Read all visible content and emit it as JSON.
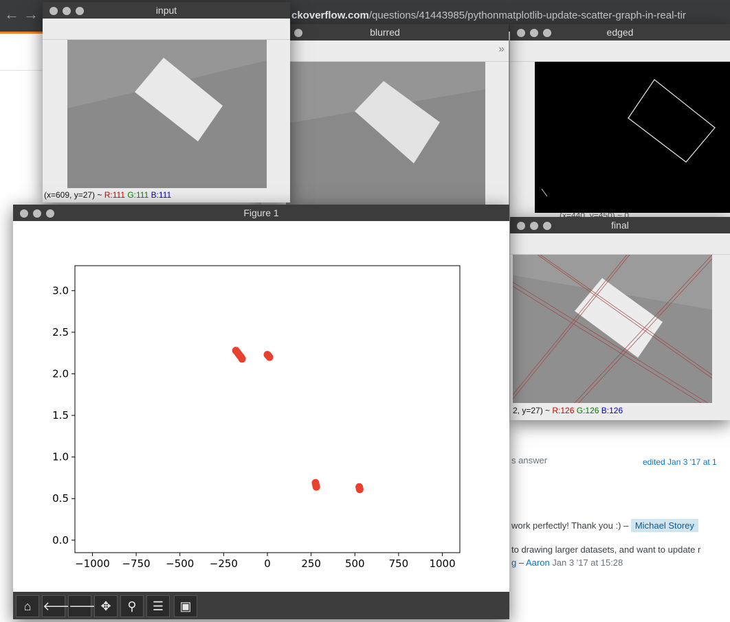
{
  "browser": {
    "url_domain": "ckoverflow.com",
    "url_path": "/questions/41443985/pythonmatplotlib-update-scatter-graph-in-real-tir"
  },
  "page": {
    "answer_label": "s answer",
    "edited_text": "edited Jan 3 '17 at 1",
    "comment1": "work perfectly! Thank you :) –",
    "comment1_user": "Michael Storey",
    "comment2_line1": "to drawing larger datasets, and want to update r",
    "comment2_prefix": "g",
    "comment2_sep": " – ",
    "comment2_user": "Aaron",
    "comment2_time": " Jan 3 '17 at 15:28"
  },
  "windows": {
    "input": {
      "title": "input",
      "status_prefix": "(x=609, y=27) ~ ",
      "r": "R:111",
      "g": "G:111",
      "b": "B:111"
    },
    "blurred": {
      "title": "blurred",
      "chevron": "»"
    },
    "edged": {
      "title": "edged",
      "status_prefix": "(x=440, y=450)  ~ 0"
    },
    "final": {
      "title": "final",
      "status_prefix": "2, y=27) ~ ",
      "r": "R:126",
      "g": "G:126",
      "b": "B:126"
    },
    "figure": {
      "title": "Figure 1",
      "toolbar": [
        {
          "name": "home-icon",
          "glyph": "⌂"
        },
        {
          "name": "back-arrow-icon",
          "glyph": "🡐"
        },
        {
          "name": "forward-arrow-icon",
          "glyph": "🡒"
        },
        {
          "name": "pan-icon",
          "glyph": "✥"
        },
        {
          "name": "zoom-icon",
          "glyph": "⚲"
        },
        {
          "name": "subplots-config-icon",
          "glyph": "☰"
        },
        {
          "name": "save-icon",
          "glyph": "▣"
        }
      ]
    }
  },
  "chart_data": {
    "type": "scatter",
    "title": "",
    "xlabel": "",
    "ylabel": "",
    "xlim": [
      -1100,
      1100
    ],
    "ylim": [
      -0.15,
      3.3
    ],
    "xticks": [
      -1000,
      -750,
      -500,
      -250,
      0,
      250,
      500,
      750,
      1000
    ],
    "xtick_labels": [
      "−1000",
      "−750",
      "−500",
      "−250",
      "0",
      "250",
      "500",
      "750",
      "1000"
    ],
    "yticks": [
      0.0,
      0.5,
      1.0,
      1.5,
      2.0,
      2.5,
      3.0
    ],
    "ytick_labels": [
      "0.0",
      "0.5",
      "1.0",
      "1.5",
      "2.0",
      "2.5",
      "3.0"
    ],
    "grid": false,
    "marker_color": "#e8412f",
    "points": [
      {
        "x": -180,
        "y": 2.28
      },
      {
        "x": -172,
        "y": 2.26
      },
      {
        "x": -165,
        "y": 2.24
      },
      {
        "x": -158,
        "y": 2.22
      },
      {
        "x": -150,
        "y": 2.2
      },
      {
        "x": -145,
        "y": 2.18
      },
      {
        "x": 0,
        "y": 2.23
      },
      {
        "x": 5,
        "y": 2.22
      },
      {
        "x": 12,
        "y": 2.2
      },
      {
        "x": 275,
        "y": 0.69
      },
      {
        "x": 278,
        "y": 0.66
      },
      {
        "x": 280,
        "y": 0.64
      },
      {
        "x": 525,
        "y": 0.64
      },
      {
        "x": 527,
        "y": 0.62
      },
      {
        "x": 528,
        "y": 0.61
      }
    ]
  }
}
